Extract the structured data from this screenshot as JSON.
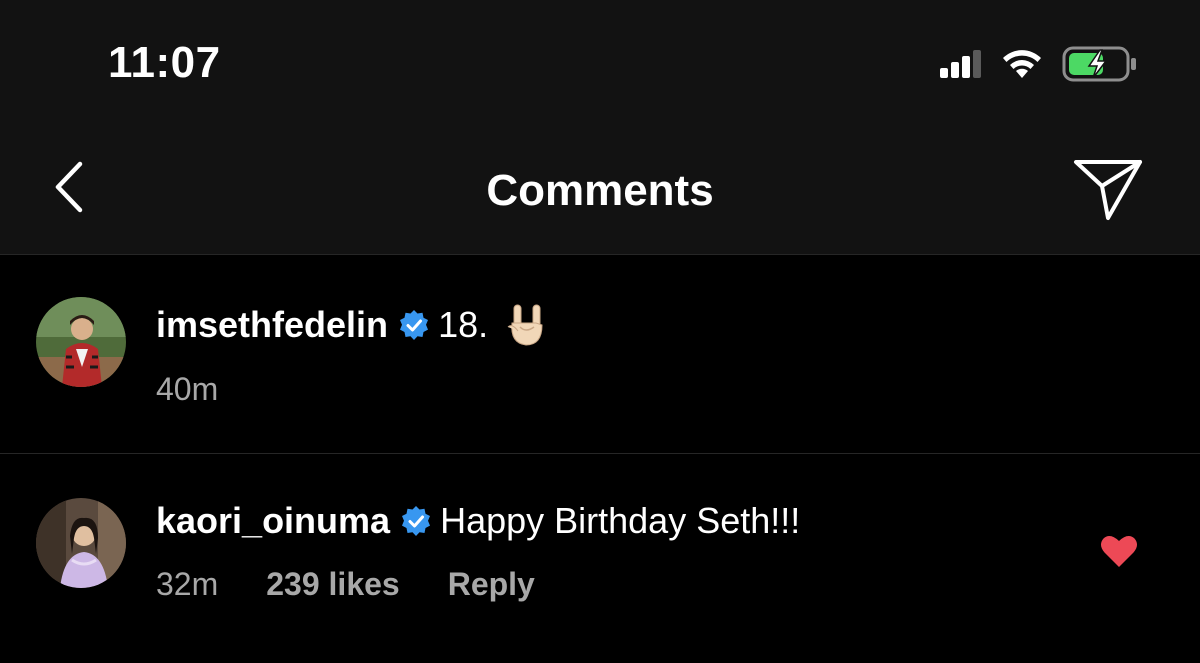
{
  "status_bar": {
    "time": "11:07",
    "icons": [
      "signal-icon",
      "wifi-icon",
      "battery-charging-icon"
    ],
    "battery_color": "#4cd964"
  },
  "header": {
    "title": "Comments",
    "back_icon": "chevron-left-icon",
    "share_icon": "paper-plane-icon"
  },
  "comments": [
    {
      "username": "imsethfedelin",
      "verified": true,
      "text": "18.",
      "emoji": "sign-of-horns-emoji",
      "time": "40m"
    },
    {
      "username": "kaori_oinuma",
      "verified": true,
      "text": "Happy Birthday Seth!!!",
      "time": "32m",
      "likes": "239 likes",
      "reply_label": "Reply",
      "liked": true,
      "heart_color": "#ed4956"
    }
  ],
  "colors": {
    "background": "#000000",
    "bar_background": "#121212",
    "verified_blue": "#3897f0",
    "meta_gray": "#a8a8a8"
  }
}
